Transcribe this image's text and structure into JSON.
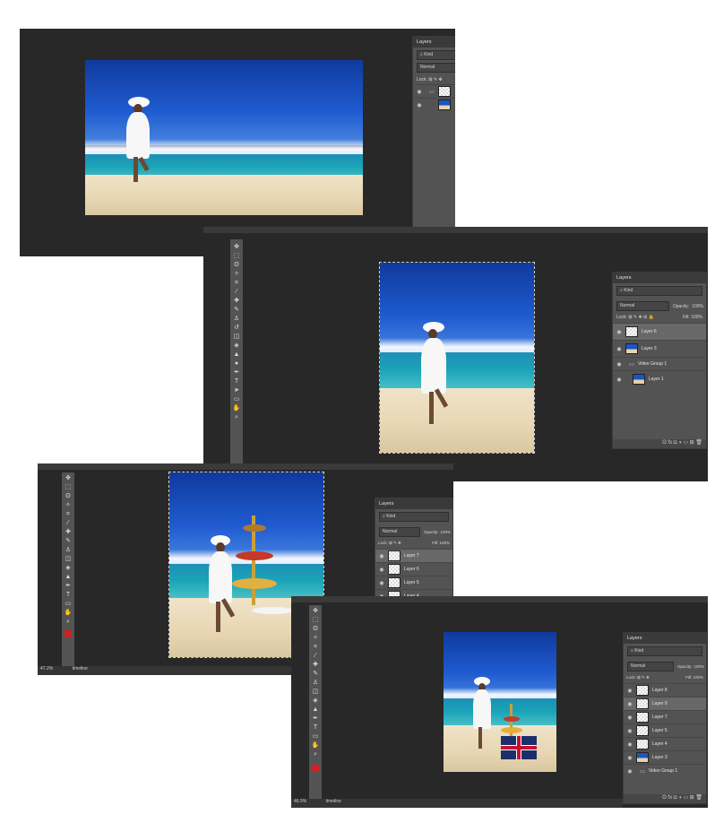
{
  "screens": [
    {
      "layers_panel": {
        "title": "Layers",
        "search": "Kind",
        "blend": "Normal",
        "lock_label": "Lock:"
      }
    },
    {
      "layers_panel": {
        "title": "Layers",
        "search": "Kind",
        "blend": "Normal",
        "opacity_label": "Opacity:",
        "opacity_value": "100%",
        "lock_label": "Lock:",
        "fill_label": "Fill:",
        "fill_value": "100%",
        "layers": [
          "Layer 6",
          "Layer 3",
          "Video Group 1",
          "Layer 1"
        ],
        "selected_index": 0
      }
    },
    {
      "layers_panel": {
        "title": "Layers",
        "search": "Kind",
        "blend": "Normal",
        "opacity_label": "Opacity:",
        "opacity_value": "100%",
        "lock_label": "Lock:",
        "fill_label": "Fill:",
        "fill_value": "100%",
        "layers": [
          "Layer 7",
          "Layer 6",
          "Layer 5",
          "Layer 4"
        ],
        "selected_index": 0
      },
      "status": {
        "zoom": "47.2%",
        "timeline_tab": "timeline"
      }
    },
    {
      "layers_panel": {
        "title": "Layers",
        "search": "Kind",
        "blend": "Normal",
        "opacity_label": "Opacity:",
        "opacity_value": "100%",
        "lock_label": "Lock:",
        "fill_label": "Fill:",
        "fill_value": "100%",
        "layers": [
          "Layer 8",
          "Layer 9",
          "Layer 7",
          "Layer 5",
          "Layer 4",
          "Layer 3",
          "Video Group 1"
        ],
        "selected_index": 1
      },
      "status": {
        "zoom": "46.9%",
        "timeline_tab": "timeline"
      }
    }
  ],
  "icons": {
    "eye": "eye-icon",
    "folder": "folder-icon",
    "search": "search-icon",
    "move": "move-icon",
    "marquee": "marquee-icon",
    "lasso": "lasso-icon",
    "wand": "magic-wand-icon",
    "crop": "crop-icon",
    "eyedropper": "eyedropper-icon",
    "brush": "brush-icon",
    "stamp": "clone-stamp-icon",
    "eraser": "eraser-icon",
    "bucket": "paint-bucket-icon",
    "pen": "pen-icon",
    "type": "type-icon",
    "zoom": "zoom-icon",
    "hand": "hand-icon"
  }
}
